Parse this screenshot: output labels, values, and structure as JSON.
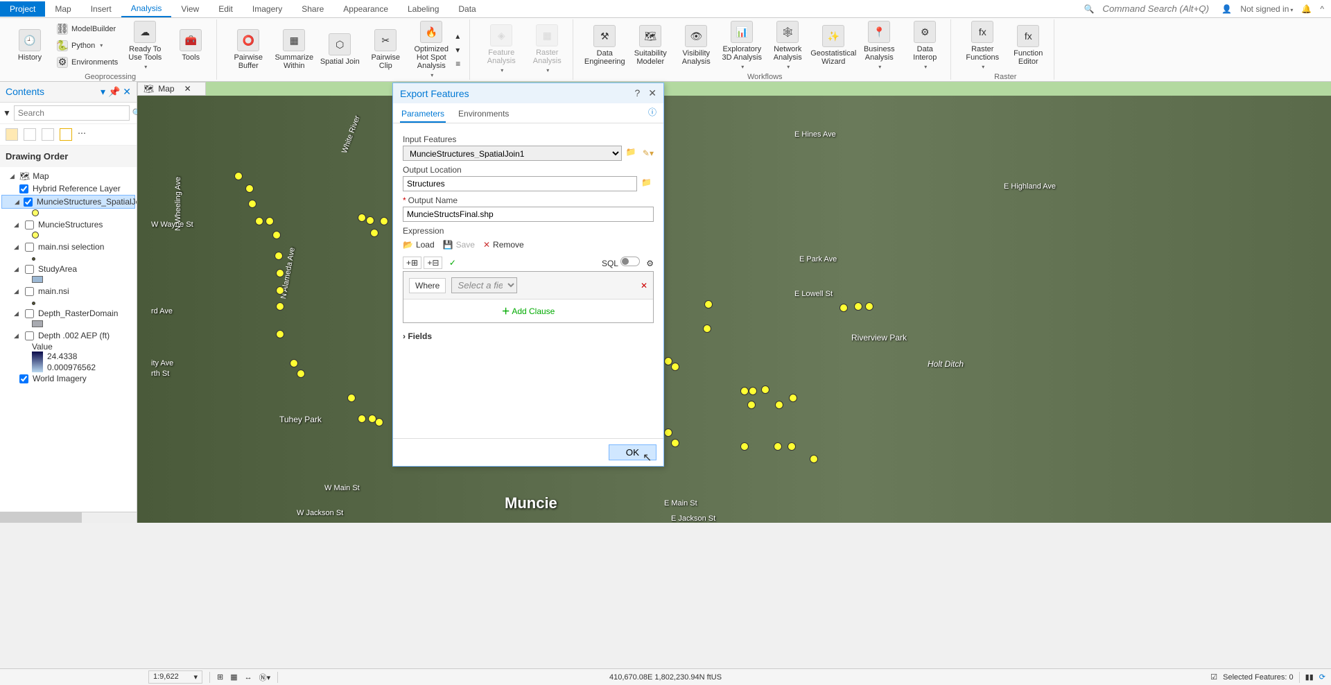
{
  "tabs": {
    "project": "Project",
    "map": "Map",
    "insert": "Insert",
    "analysis": "Analysis",
    "view": "View",
    "edit": "Edit",
    "imagery": "Imagery",
    "share": "Share",
    "appearance": "Appearance",
    "labeling": "Labeling",
    "data": "Data"
  },
  "header": {
    "command_search_placeholder": "Command Search (Alt+Q)",
    "signin": "Not signed in"
  },
  "ribbon": {
    "history": "History",
    "modelbuilder": "ModelBuilder",
    "python": "Python",
    "environments": "Environments",
    "ready_to_use": "Ready To Use Tools",
    "tools": "Tools",
    "geoprocessing": "Geoprocessing",
    "pairwise_buffer": "Pairwise Buffer",
    "summarize_within": "Summarize Within",
    "spatial_join": "Spatial Join",
    "pairwise_clip": "Pairwise Clip",
    "optimized_hotspot": "Optimized Hot Spot Analysis",
    "tools_label": "Tools",
    "feature_analysis": "Feature Analysis",
    "raster_analysis": "Raster Analysis",
    "data_engineering": "Data Engineering",
    "suitability_modeler": "Suitability Modeler",
    "visibility_analysis": "Visibility Analysis",
    "exploratory_3d": "Exploratory 3D Analysis",
    "network_analysis": "Network Analysis",
    "geostat_wizard": "Geostatistical Wizard",
    "business_analysis": "Business Analysis",
    "data_interop": "Data Interop",
    "workflows": "Workflows",
    "raster_functions": "Raster Functions",
    "function_editor": "Function Editor",
    "raster_label": "Raster"
  },
  "contents": {
    "title": "Contents",
    "search_placeholder": "Search",
    "drawing_order": "Drawing Order",
    "map": "Map",
    "layers": {
      "hybrid": "Hybrid Reference Layer",
      "spatial_join": "MuncieStructures_SpatialJoi",
      "muncie_structures": "MuncieStructures",
      "nsi_selection": "main.nsi selection",
      "study_area": "StudyArea",
      "main_nsi": "main.nsi",
      "depth_raster": "Depth_RasterDomain",
      "depth_aep": "Depth .002 AEP (ft)",
      "value": "Value",
      "val_max": "24.4338",
      "val_min": "0.000976562",
      "world_imagery": "World Imagery"
    }
  },
  "map_tab": "Map",
  "dialog": {
    "title": "Export Features",
    "tabs": {
      "parameters": "Parameters",
      "environments": "Environments"
    },
    "labels": {
      "input_features": "Input Features",
      "output_location": "Output Location",
      "output_name": "Output Name",
      "expression": "Expression",
      "load": "Load",
      "save": "Save",
      "remove": "Remove",
      "sql": "SQL",
      "where": "Where",
      "select_field": "Select a field",
      "add_clause": "Add Clause",
      "fields": "Fields"
    },
    "values": {
      "input_features": "MuncieStructures_SpatialJoin1",
      "output_location": "Structures",
      "output_name": "MuncieStructsFinal.shp"
    },
    "ok": "OK"
  },
  "status": {
    "scale": "1:9,622",
    "coords": "410,670.08E 1,802,230.94N ftUS",
    "selected": "Selected Features: 0"
  },
  "map_labels": {
    "muncie": "Muncie",
    "tuhey": "Tuhey Park",
    "riverview": "Riverview Park",
    "holt": "Holt Ditch"
  }
}
